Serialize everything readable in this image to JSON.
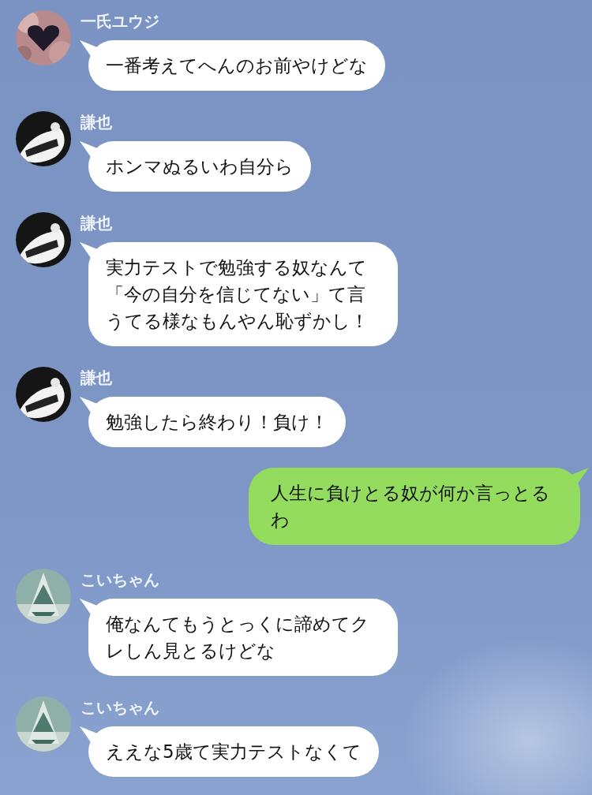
{
  "messages": [
    {
      "kind": "received",
      "sender": "一氏ユウジ",
      "text": "一番考えてへんのお前やけどな"
    },
    {
      "kind": "received",
      "sender": "謙也",
      "text": "ホンマぬるいわ自分ら"
    },
    {
      "kind": "received",
      "sender": "謙也",
      "text": "実力テストで勉強する奴なんて「今の自分を信じてない」て言うてる様なもんやん恥ずかし！"
    },
    {
      "kind": "received",
      "sender": "謙也",
      "text": "勉強したら終わり！負け！"
    },
    {
      "kind": "sent",
      "text": "人生に負けとる奴が何か言っとるわ"
    },
    {
      "kind": "received",
      "sender": "こいちゃん",
      "text": "俺なんてもうとっくに諦めてクレしん見とるけどな"
    },
    {
      "kind": "received",
      "sender": "こいちゃん",
      "text": "ええな5歳て実力テストなくて"
    }
  ]
}
